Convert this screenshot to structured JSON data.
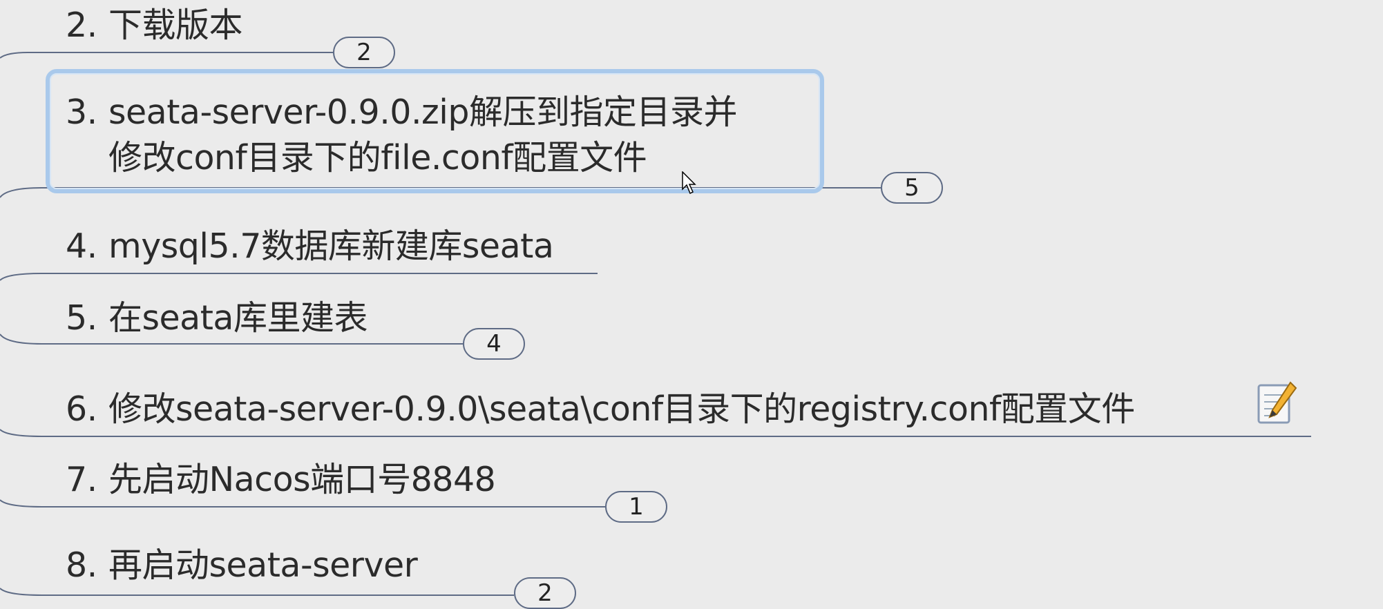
{
  "topics": [
    {
      "num": "2.",
      "text": "下载版本",
      "badge": "2"
    },
    {
      "num": "3.",
      "text_line1": "seata-server-0.9.0.zip解压到指定目录并",
      "text_line2": "修改conf目录下的file.conf配置文件",
      "badge": "5"
    },
    {
      "num": "4.",
      "text": "mysql5.7数据库新建库seata"
    },
    {
      "num": "5.",
      "text": "在seata库里建表",
      "badge": "4"
    },
    {
      "num": "6.",
      "text": "修改seata-server-0.9.0\\seata\\conf目录下的registry.conf配置文件",
      "note_icon": "note-pencil-icon"
    },
    {
      "num": "7.",
      "text": "先启动Nacos端口号8848",
      "badge": "1"
    },
    {
      "num": "8.",
      "text": "再启动seata-server",
      "badge": "2"
    }
  ],
  "colors": {
    "background": "#ebebeb",
    "connector": "#5e6b85",
    "selection": "#a9c9eb",
    "text": "#2b2b2b"
  }
}
